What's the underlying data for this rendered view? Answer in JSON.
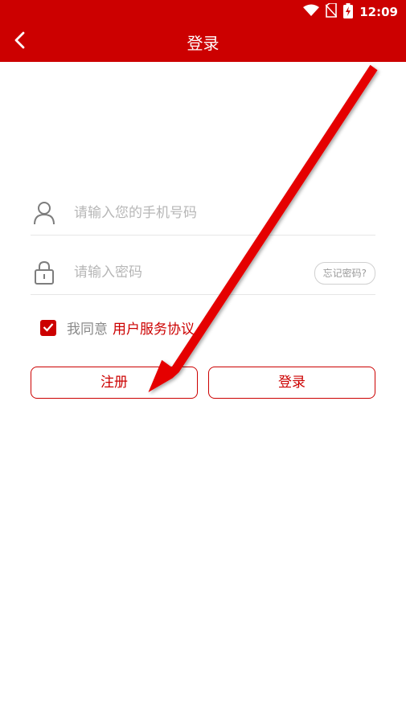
{
  "status_bar": {
    "time": "12:09",
    "icons": [
      "wifi-icon",
      "no-sim-icon",
      "battery-charging-icon"
    ]
  },
  "header": {
    "title": "登录",
    "back_icon": "back-arrow-icon"
  },
  "phone_field": {
    "placeholder": "请输入您的手机号码",
    "value": "",
    "icon": "user-icon"
  },
  "password_field": {
    "placeholder": "请输入密码",
    "value": "",
    "icon": "lock-icon",
    "forgot_label": "忘记密码?"
  },
  "agreement": {
    "checked": true,
    "text": "我同意",
    "link_label": "用户服务协议"
  },
  "buttons": {
    "register_label": "注册",
    "login_label": "登录"
  },
  "colors": {
    "brand": "#cc0000",
    "annotation_arrow": "#e50000"
  }
}
